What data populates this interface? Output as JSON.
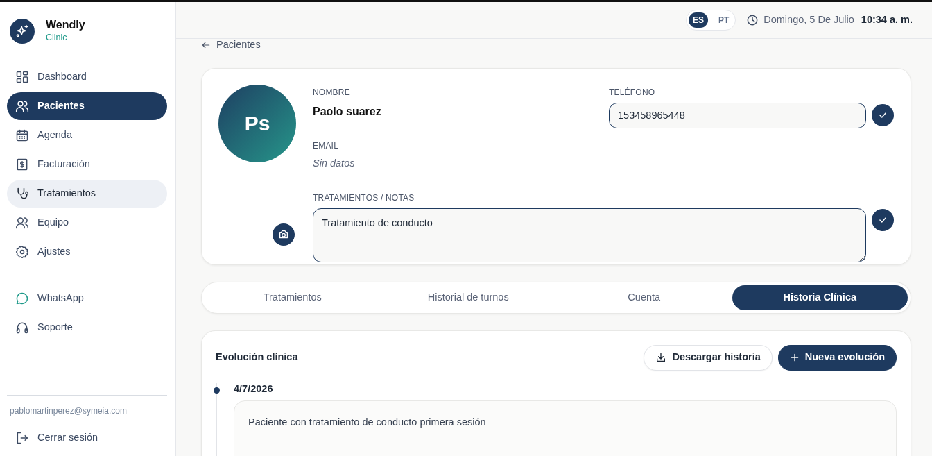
{
  "brand": {
    "name": "Wendly",
    "subtitle": "Clinic"
  },
  "sidebar": {
    "items": [
      {
        "label": "Dashboard",
        "selected": false,
        "hovered": false
      },
      {
        "label": "Pacientes",
        "selected": true,
        "hovered": false
      },
      {
        "label": "Agenda",
        "selected": false,
        "hovered": false
      },
      {
        "label": "Facturación",
        "selected": false,
        "hovered": false
      },
      {
        "label": "Tratamientos",
        "selected": false,
        "hovered": true
      },
      {
        "label": "Equipo",
        "selected": false,
        "hovered": false
      },
      {
        "label": "Ajustes",
        "selected": false,
        "hovered": false
      }
    ],
    "extra_items": [
      {
        "label": "WhatsApp"
      },
      {
        "label": "Soporte"
      }
    ],
    "user_email": "pablomartinperez@symeia.com",
    "logout": "Cerrar sesión"
  },
  "header": {
    "languages": [
      {
        "label": "ES",
        "selected": true
      },
      {
        "label": "PT",
        "selected": false
      }
    ],
    "date": "Domingo, 5 De Julio",
    "time": "10:34 a. m."
  },
  "back_link": "Pacientes",
  "patient": {
    "initials": "Ps",
    "name_label": "NOMBRE",
    "name": "Paolo suarez",
    "phone_label": "TELÉFONO",
    "phone": "153458965448",
    "email_label": "EMAIL",
    "email": "Sin datos",
    "notes_label": "TRATAMIENTOS / NOTAS",
    "notes": "Tratamiento de conducto"
  },
  "tabs": [
    {
      "label": "Tratamientos",
      "selected": false
    },
    {
      "label": "Historial de turnos",
      "selected": false
    },
    {
      "label": "Cuenta",
      "selected": false
    },
    {
      "label": "Historia Clínica",
      "selected": true
    }
  ],
  "evolution": {
    "title": "Evolución clínica",
    "download_button": "Descargar historia",
    "new_button": "Nueva evolución",
    "entries": [
      {
        "date": "4/7/2026",
        "text": "Paciente con tratamiento de conducto primera sesión"
      }
    ]
  }
}
